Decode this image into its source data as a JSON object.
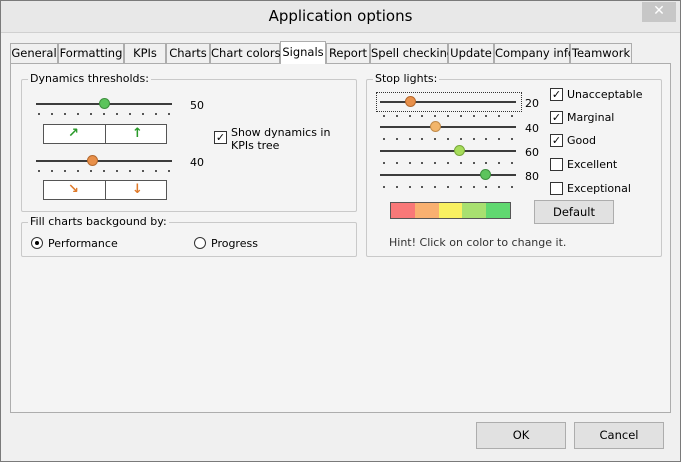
{
  "window": {
    "title": "Application options",
    "close_symbol": "✕"
  },
  "tabs": [
    {
      "label": "General",
      "active": false
    },
    {
      "label": "Formatting",
      "active": false
    },
    {
      "label": "KPIs",
      "active": false
    },
    {
      "label": "Charts",
      "active": false
    },
    {
      "label": "Chart colors",
      "active": false
    },
    {
      "label": "Signals",
      "active": true
    },
    {
      "label": "Report",
      "active": false
    },
    {
      "label": "Spell checking",
      "active": false
    },
    {
      "label": "Update",
      "active": false
    },
    {
      "label": "Company info",
      "active": false
    },
    {
      "label": "Teamwork",
      "active": false
    }
  ],
  "dynamics": {
    "label": "Dynamics thresholds:",
    "up_slider_value": "50",
    "down_slider_value": "40",
    "up_thumb_color": "#5cc45c",
    "down_thumb_color": "#e8904a",
    "up_arrow_color": "#2a9a2a",
    "down_arrow_color": "#e07a2a",
    "up_arrows": [
      "↗",
      "↑"
    ],
    "down_arrows": [
      "↘",
      "↓"
    ],
    "show_dynamics": {
      "checked": true,
      "label_line1": "Show dynamics in",
      "label_line2": "KPIs tree"
    }
  },
  "fill": {
    "label": "Fill charts backgound by:",
    "options": [
      {
        "label": "Performance",
        "selected": true
      },
      {
        "label": "Progress",
        "selected": false
      }
    ]
  },
  "stoplights": {
    "label": "Stop lights:",
    "sliders": [
      {
        "value": "20",
        "thumb_color": "#e8904a"
      },
      {
        "value": "40",
        "thumb_color": "#f2b56a"
      },
      {
        "value": "60",
        "thumb_color": "#a6dc5a"
      },
      {
        "value": "80",
        "thumb_color": "#5cc45c"
      }
    ],
    "checkboxes": [
      {
        "label": "Unacceptable",
        "checked": true
      },
      {
        "label": "Marginal",
        "checked": true
      },
      {
        "label": "Good",
        "checked": true
      },
      {
        "label": "Excellent",
        "checked": false
      },
      {
        "label": "Exceptional",
        "checked": false
      }
    ],
    "colors": [
      "#f87878",
      "#f8b070",
      "#f8f060",
      "#a8e070",
      "#60d870"
    ],
    "default_button": "Default",
    "hint": "Hint! Click on color to change it."
  },
  "buttons": {
    "ok": "OK",
    "cancel": "Cancel"
  }
}
